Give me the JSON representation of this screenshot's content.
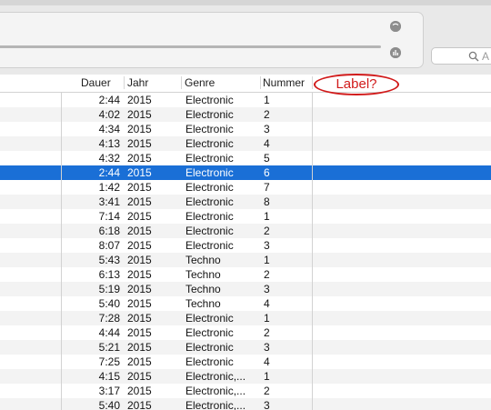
{
  "search": {
    "placeholder_visible": "A"
  },
  "columns": {
    "dauer": "Dauer",
    "jahr": "Jahr",
    "genre": "Genre",
    "nummer": "Nummer"
  },
  "annotation": {
    "text": "Label?",
    "color": "#d11a1a"
  },
  "accent": {
    "selection": "#1a6fd6"
  },
  "rows": [
    {
      "duration": "2:44",
      "year": "2015",
      "genre": "Electronic",
      "number": "1"
    },
    {
      "duration": "4:02",
      "year": "2015",
      "genre": "Electronic",
      "number": "2"
    },
    {
      "duration": "4:34",
      "year": "2015",
      "genre": "Electronic",
      "number": "3"
    },
    {
      "duration": "4:13",
      "year": "2015",
      "genre": "Electronic",
      "number": "4"
    },
    {
      "duration": "4:32",
      "year": "2015",
      "genre": "Electronic",
      "number": "5"
    },
    {
      "duration": "2:44",
      "year": "2015",
      "genre": "Electronic",
      "number": "6",
      "selected": true
    },
    {
      "duration": "1:42",
      "year": "2015",
      "genre": "Electronic",
      "number": "7"
    },
    {
      "duration": "3:41",
      "year": "2015",
      "genre": "Electronic",
      "number": "8"
    },
    {
      "duration": "7:14",
      "year": "2015",
      "genre": "Electronic",
      "number": "1"
    },
    {
      "duration": "6:18",
      "year": "2015",
      "genre": "Electronic",
      "number": "2"
    },
    {
      "duration": "8:07",
      "year": "2015",
      "genre": "Electronic",
      "number": "3"
    },
    {
      "duration": "5:43",
      "year": "2015",
      "genre": "Techno",
      "number": "1"
    },
    {
      "duration": "6:13",
      "year": "2015",
      "genre": "Techno",
      "number": "2"
    },
    {
      "duration": "5:19",
      "year": "2015",
      "genre": "Techno",
      "number": "3"
    },
    {
      "duration": "5:40",
      "year": "2015",
      "genre": "Techno",
      "number": "4"
    },
    {
      "duration": "7:28",
      "year": "2015",
      "genre": "Electronic",
      "number": "1"
    },
    {
      "duration": "4:44",
      "year": "2015",
      "genre": "Electronic",
      "number": "2"
    },
    {
      "duration": "5:21",
      "year": "2015",
      "genre": "Electronic",
      "number": "3"
    },
    {
      "duration": "7:25",
      "year": "2015",
      "genre": "Electronic",
      "number": "4"
    },
    {
      "duration": "4:15",
      "year": "2015",
      "genre": "Electronic,...",
      "number": "1"
    },
    {
      "duration": "3:17",
      "year": "2015",
      "genre": "Electronic,...",
      "number": "2"
    },
    {
      "duration": "5:40",
      "year": "2015",
      "genre": "Electronic,...",
      "number": "3"
    }
  ]
}
